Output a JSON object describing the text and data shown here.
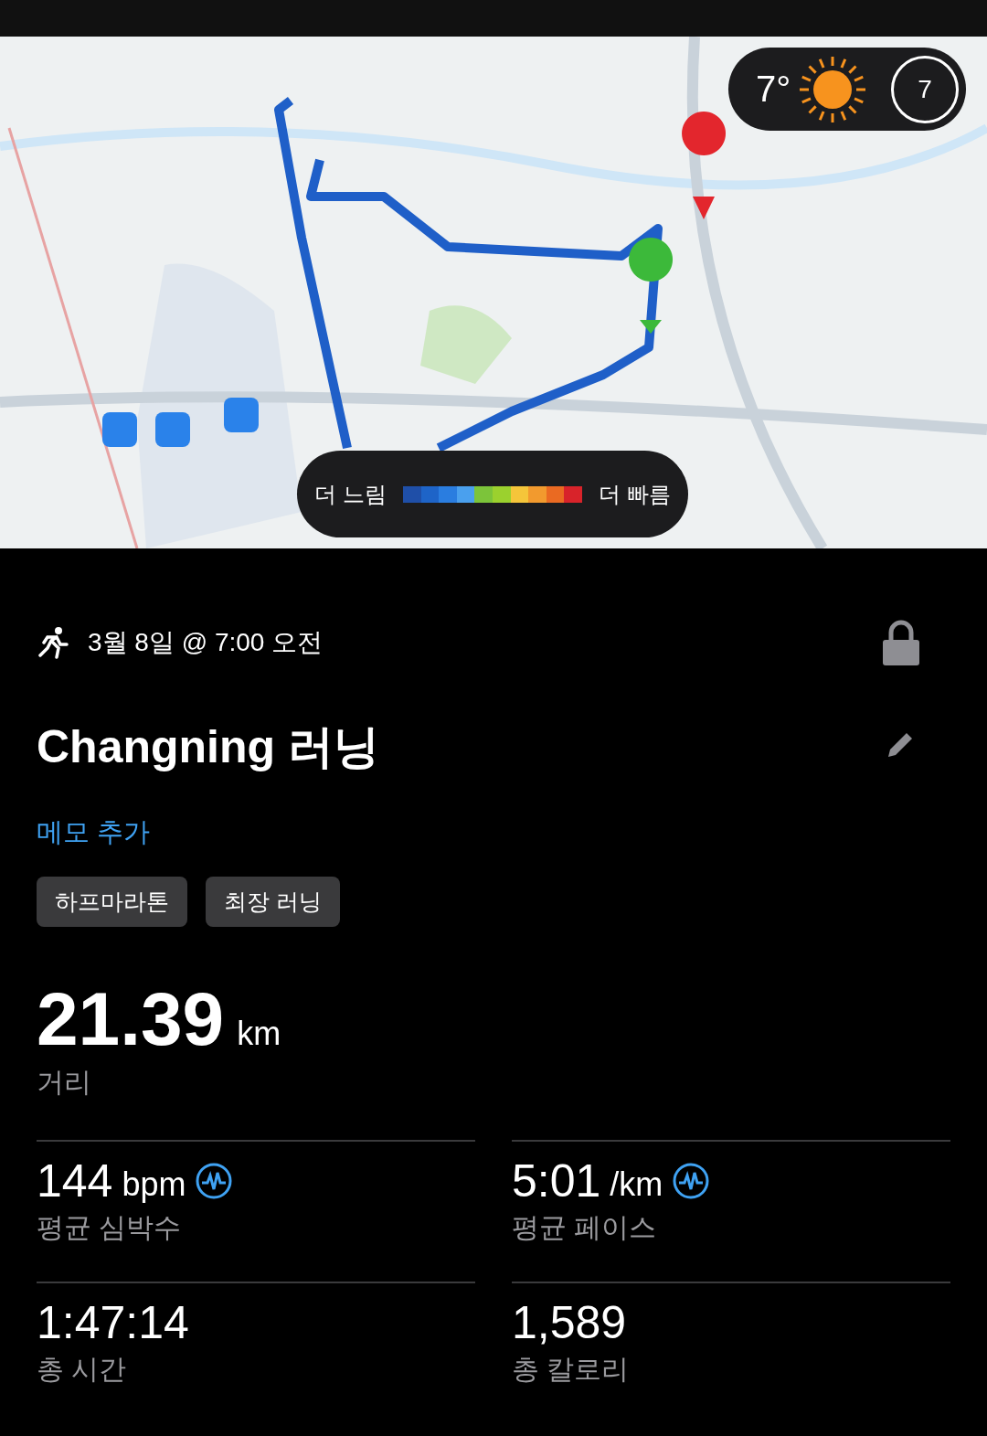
{
  "weather": {
    "temperature": "7°",
    "compass": "7"
  },
  "pace_legend": {
    "slow_label": "더 느림",
    "fast_label": "더 빠름",
    "segments": [
      {
        "color": "#1f4fa8"
      },
      {
        "color": "#1e64c8"
      },
      {
        "color": "#2a7de0"
      },
      {
        "color": "#4aa0ee"
      },
      {
        "color": "#7cc43a"
      },
      {
        "color": "#9bd12e"
      },
      {
        "color": "#f5c53a"
      },
      {
        "color": "#f29a2e"
      },
      {
        "color": "#ea6a22"
      },
      {
        "color": "#d8232a"
      }
    ]
  },
  "activity": {
    "date": "3월 8일 @ 7:00 오전",
    "title": "Changning 러닝",
    "memo_link": "메모 추가",
    "tags": [
      "하프마라톤",
      "최장 러닝"
    ]
  },
  "distance": {
    "value": "21.39",
    "unit": "km",
    "label": "거리"
  },
  "stats": [
    {
      "value": "144",
      "unit": "bpm",
      "label": "평균 심박수",
      "zone_icon": true
    },
    {
      "value": "5:01",
      "unit": "/km",
      "label": "평균 페이스",
      "zone_icon": true
    },
    {
      "value": "1:47:14",
      "label": "총 시간",
      "zone_icon": false
    },
    {
      "value": "1,589",
      "label": "총 칼로리",
      "zone_icon": false
    }
  ]
}
